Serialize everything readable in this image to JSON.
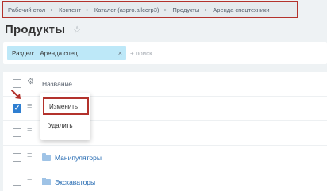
{
  "breadcrumb": {
    "items": [
      "Рабочий стол",
      "Контент",
      "Каталог (aspro.allcorp3)",
      "Продукты",
      "Аренда спецтехники"
    ],
    "separator": "▸"
  },
  "page": {
    "title": "Продукты",
    "star_glyph": "☆"
  },
  "filter": {
    "chip_label": "Раздел: . Аренда спецт...",
    "chip_close": "×",
    "search_placeholder": "+ поиск"
  },
  "grid": {
    "header_label": "Название",
    "gear_glyph": "⚙",
    "row_menu_glyph": "≡",
    "checkmark": "✓",
    "rows": [
      {
        "label": "",
        "checked": true
      },
      {
        "label": "",
        "checked": false
      },
      {
        "label": "Манипуляторы",
        "checked": false
      },
      {
        "label": "Экскаваторы",
        "checked": false
      }
    ]
  },
  "context_menu": {
    "items": [
      "Изменить",
      "Удалить"
    ]
  },
  "colors": {
    "highlight_border": "#b3322c",
    "chip_bg": "#bde8f8",
    "link": "#2067b0",
    "checkbox_checked": "#2f7fd1"
  }
}
